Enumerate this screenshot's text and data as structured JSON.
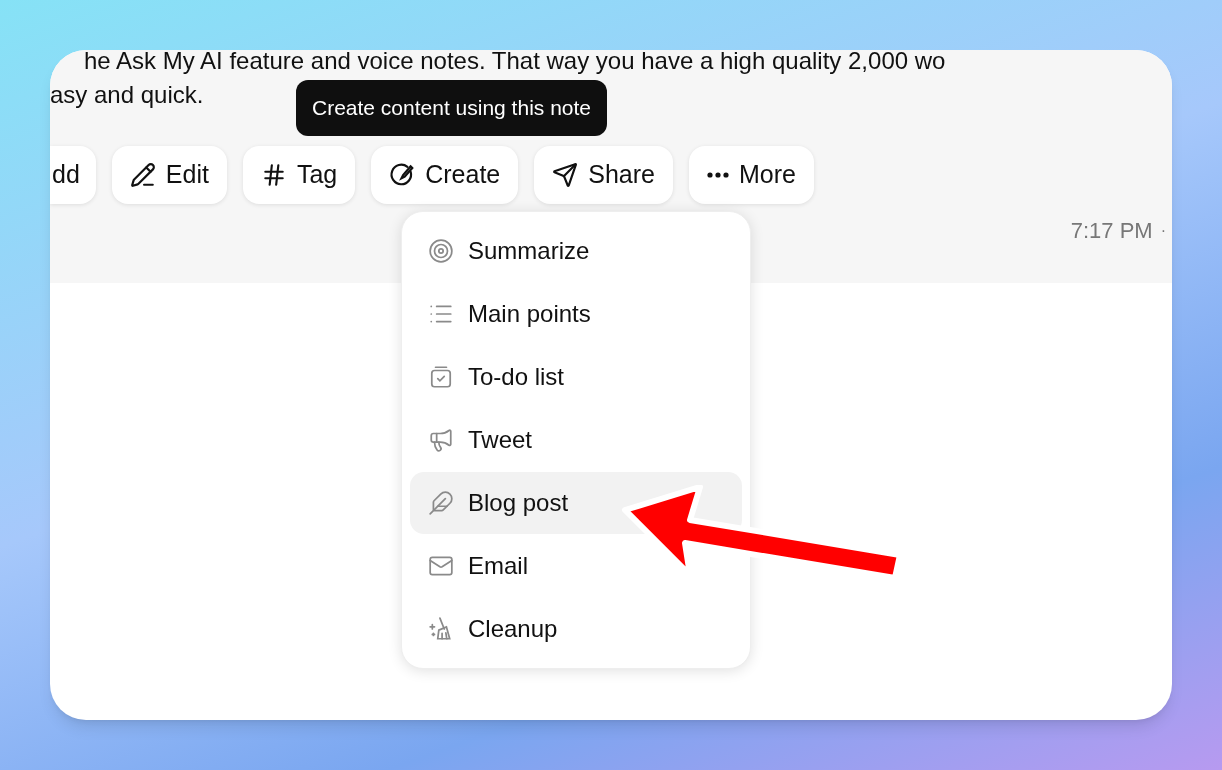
{
  "note": {
    "lines": [
      "he Ask My AI feature and voice notes. That way you have a high quality 2,000 wo",
      "asy and quick."
    ]
  },
  "tooltip": "Create content using this note",
  "actions": [
    {
      "label": "dd"
    },
    {
      "label": "Edit"
    },
    {
      "label": "Tag"
    },
    {
      "label": "Create"
    },
    {
      "label": "Share"
    },
    {
      "label": "More"
    }
  ],
  "timestamp": "7:17 PM",
  "separator": "·",
  "menu": {
    "items": [
      {
        "label": "Summarize",
        "selected": false
      },
      {
        "label": "Main points",
        "selected": false
      },
      {
        "label": "To-do list",
        "selected": false
      },
      {
        "label": "Tweet",
        "selected": false
      },
      {
        "label": "Blog post",
        "selected": true
      },
      {
        "label": "Email",
        "selected": false
      },
      {
        "label": "Cleanup",
        "selected": false
      }
    ]
  }
}
